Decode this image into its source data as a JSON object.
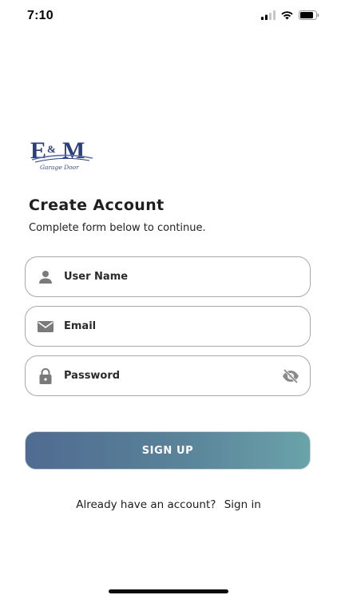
{
  "status_bar": {
    "time": "7:10"
  },
  "logo": {
    "letters": "E&M",
    "tagline": "Garage Door"
  },
  "header": {
    "title": "Create Account",
    "subtitle": "Complete form below to continue."
  },
  "form": {
    "username": {
      "placeholder": "User Name",
      "value": "",
      "icon": "person-icon"
    },
    "email": {
      "placeholder": "Email",
      "value": "",
      "icon": "mail-icon"
    },
    "password": {
      "placeholder": "Password",
      "value": "",
      "icon": "lock-icon",
      "toggle_icon": "eye-off-icon"
    }
  },
  "actions": {
    "signup_label": "SIGN UP",
    "signin_prompt": "Already have an account?",
    "signin_link": "Sign in"
  },
  "colors": {
    "gradient_start": "#4f6b91",
    "gradient_end": "#6aa3a9",
    "icon_gray": "#7a7a7a",
    "logo_blue": "#2b3f7a"
  }
}
